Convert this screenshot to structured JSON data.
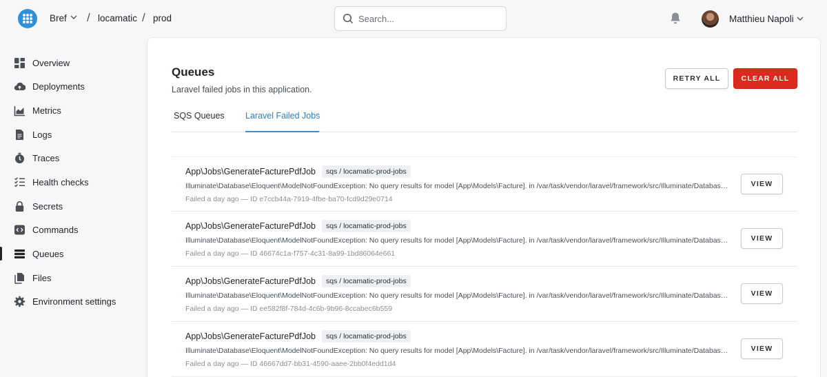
{
  "header": {
    "org": "Bref",
    "app": "locamatic",
    "env": "prod",
    "search_placeholder": "Search...",
    "user_name": "Matthieu Napoli"
  },
  "sidebar": {
    "items": [
      {
        "label": "Overview",
        "icon": "dashboard-icon"
      },
      {
        "label": "Deployments",
        "icon": "cloud-upload-icon"
      },
      {
        "label": "Metrics",
        "icon": "chart-icon"
      },
      {
        "label": "Logs",
        "icon": "document-icon"
      },
      {
        "label": "Traces",
        "icon": "stopwatch-icon"
      },
      {
        "label": "Health checks",
        "icon": "checklist-icon"
      },
      {
        "label": "Secrets",
        "icon": "lock-icon"
      },
      {
        "label": "Commands",
        "icon": "terminal-icon"
      },
      {
        "label": "Queues",
        "icon": "queue-icon",
        "active": true
      },
      {
        "label": "Files",
        "icon": "files-icon"
      },
      {
        "label": "Environment settings",
        "icon": "gear-icon"
      }
    ]
  },
  "main": {
    "title": "Queues",
    "subtitle": "Laravel failed jobs in this application.",
    "retry_all_label": "RETRY ALL",
    "clear_all_label": "CLEAR ALL",
    "tabs": [
      {
        "label": "SQS Queues",
        "active": false
      },
      {
        "label": "Laravel Failed Jobs",
        "active": true
      }
    ],
    "jobs": [
      {
        "name": "App\\Jobs\\GenerateFacturePdfJob",
        "queue": "sqs / locamatic-prod-jobs",
        "error": "Illuminate\\Database\\Eloquent\\ModelNotFoundException: No query results for model [App\\Models\\Facture]. in /var/task/vendor/laravel/framework/src/Illuminate/Database/Eloquent/Builder.php",
        "meta": "Failed a day ago — ID e7ccb44a-7919-4fbe-ba70-fcd9d29e0714",
        "view_label": "VIEW"
      },
      {
        "name": "App\\Jobs\\GenerateFacturePdfJob",
        "queue": "sqs / locamatic-prod-jobs",
        "error": "Illuminate\\Database\\Eloquent\\ModelNotFoundException: No query results for model [App\\Models\\Facture]. in /var/task/vendor/laravel/framework/src/Illuminate/Database/Eloquent/Builder.php",
        "meta": "Failed a day ago — ID 46674c1a-f757-4c31-8a99-1bd86064e661",
        "view_label": "VIEW"
      },
      {
        "name": "App\\Jobs\\GenerateFacturePdfJob",
        "queue": "sqs / locamatic-prod-jobs",
        "error": "Illuminate\\Database\\Eloquent\\ModelNotFoundException: No query results for model [App\\Models\\Facture]. in /var/task/vendor/laravel/framework/src/Illuminate/Database/Eloquent/Builder.php",
        "meta": "Failed a day ago — ID ee582f8f-784d-4c6b-9b96-8ccabec6b559",
        "view_label": "VIEW"
      },
      {
        "name": "App\\Jobs\\GenerateFacturePdfJob",
        "queue": "sqs / locamatic-prod-jobs",
        "error": "Illuminate\\Database\\Eloquent\\ModelNotFoundException: No query results for model [App\\Models\\Facture]. in /var/task/vendor/laravel/framework/src/Illuminate/Database/Eloquent/Builder.php",
        "meta": "Failed a day ago — ID 46667dd7-bb31-4590-aaee-2bb0f4edd1d4",
        "view_label": "VIEW"
      }
    ]
  },
  "colors": {
    "accent": "#2f8fd8",
    "danger": "#dc2a1f"
  }
}
